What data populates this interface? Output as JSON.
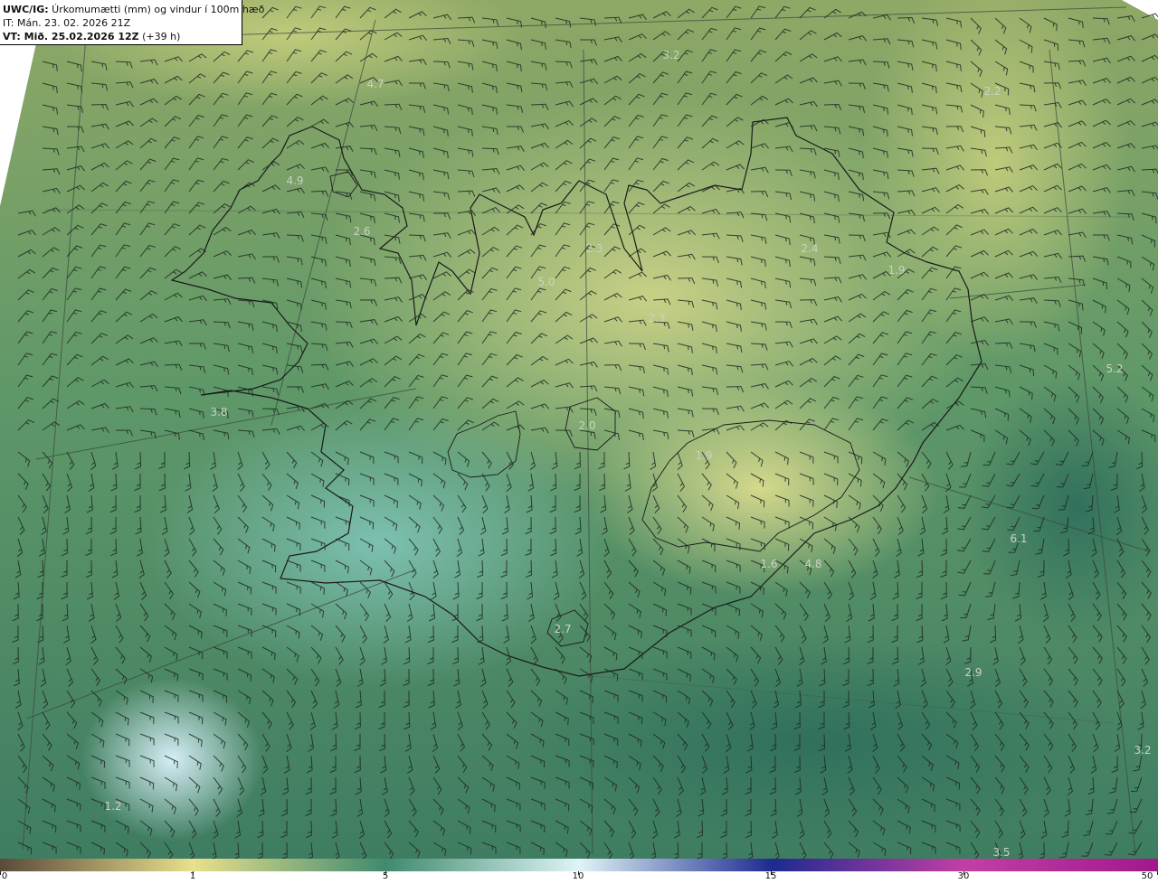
{
  "header": {
    "model": "UWC/IG:",
    "title": " Úrkomumætti (mm) og vindur í 100m hæð",
    "it_label": "IT:",
    "it_value": " Mán. 23. 02. 2026 21Z",
    "vt_label": "VT: Mið. 25.02.2026 12Z",
    "vt_value": " (+39 h)"
  },
  "point_values": [
    {
      "label": "4.7"
    },
    {
      "label": "3.2"
    },
    {
      "label": "2.2"
    },
    {
      "label": "4.9"
    },
    {
      "label": "2.6"
    },
    {
      "label": "2.3"
    },
    {
      "label": "2.4"
    },
    {
      "label": "1.9"
    },
    {
      "label": "5.0"
    },
    {
      "label": "2.3"
    },
    {
      "label": "5.2"
    },
    {
      "label": "3.8"
    },
    {
      "label": "2.0"
    },
    {
      "label": "1.9"
    },
    {
      "label": "6.1"
    },
    {
      "label": "4.8"
    },
    {
      "label": "1.6"
    },
    {
      "label": "2.7"
    },
    {
      "label": "2.9"
    },
    {
      "label": "3.2"
    },
    {
      "label": "1.2"
    },
    {
      "label": "3.5"
    }
  ],
  "colorbar": {
    "ticks": [
      "0",
      "1",
      "5",
      "10",
      "15",
      "30",
      "50"
    ],
    "colors": {
      "c0": "#5a4a3a",
      "c1": "#e8e08c",
      "c5": "#3f8a6e",
      "c10": "#dff4f6",
      "c15": "#1d2a8f",
      "c30": "#c23fa4",
      "c50": "#a0198c"
    }
  },
  "map_colors": {
    "outside": "#ffffff",
    "sea_dark": "#3f7d62",
    "sea_mid": "#5a946a",
    "land_light": "#c5cf7c",
    "teal": "#6fb3a4",
    "pale": "#c9e6ef",
    "coast": "#1a1a1a"
  }
}
